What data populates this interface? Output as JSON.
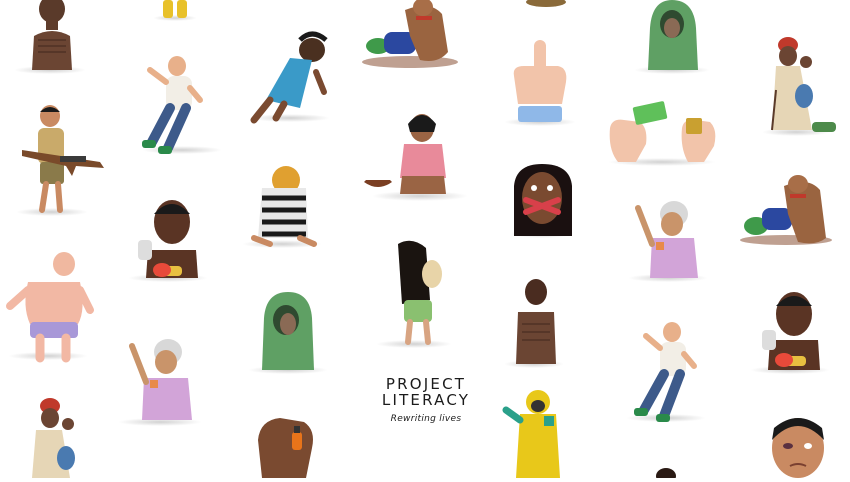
{
  "logo": {
    "line1": "PROJECT",
    "line2": "LITERACY",
    "tagline": "Rewriting lives"
  },
  "colors": {
    "background": "#ffffff",
    "logo_text": "#1b1b1b"
  },
  "figures": [
    "thin-boy-figure",
    "yellow-boots-figure",
    "dog-attacking-figure",
    "tan-object-figure",
    "green-hoodie-figure",
    "falling-man-figure",
    "rag-doll-figure",
    "middle-finger-hand-figure",
    "woman-with-baby-figure",
    "child-soldier-figure",
    "crouching-girl-figure",
    "hands-with-money-figure",
    "hiding-prisoner-figure",
    "gagged-woman-figure",
    "grandmother-figure",
    "boy-with-bottle-figure",
    "dog-attacking-figure",
    "sunburned-man-figure",
    "hair-covered-girl-figure",
    "green-hoodie-figure",
    "thin-man-figure",
    "falling-man-figure",
    "grandmother-figure",
    "boy-with-bottle-figure",
    "woman-with-baby-figure",
    "hand-holding-bottle-figure",
    "hazmat-suit-figure",
    "bruised-man-figure"
  ]
}
